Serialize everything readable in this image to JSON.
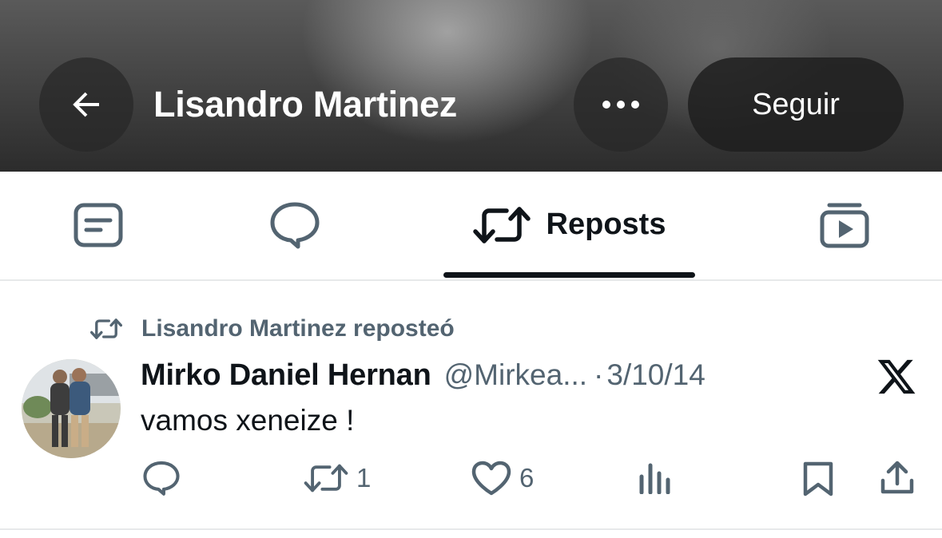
{
  "header": {
    "title": "Lisandro Martinez",
    "back_icon": "arrow-left-icon",
    "more_icon": "more-horizontal-icon",
    "follow_label": "Seguir"
  },
  "tabs": [
    {
      "name": "posts",
      "icon": "posts-icon",
      "label": ""
    },
    {
      "name": "replies",
      "icon": "reply-bubble-icon",
      "label": ""
    },
    {
      "name": "reposts",
      "icon": "repost-icon",
      "label": "Reposts",
      "active": true
    },
    {
      "name": "media",
      "icon": "media-icon",
      "label": ""
    }
  ],
  "post": {
    "repost_context": "Lisandro Martinez reposteó",
    "author": "Mirko Daniel Hernan",
    "handle": "@Mirkea...",
    "separator": "·",
    "date": "3/10/14",
    "text": "vamos xeneize !",
    "source_icon": "x-logo-icon",
    "actions": {
      "reply_count": "",
      "repost_count": "1",
      "like_count": "6"
    }
  },
  "colors": {
    "text_primary": "#0f1419",
    "text_secondary": "#536471",
    "divider": "#e7e9ea"
  }
}
